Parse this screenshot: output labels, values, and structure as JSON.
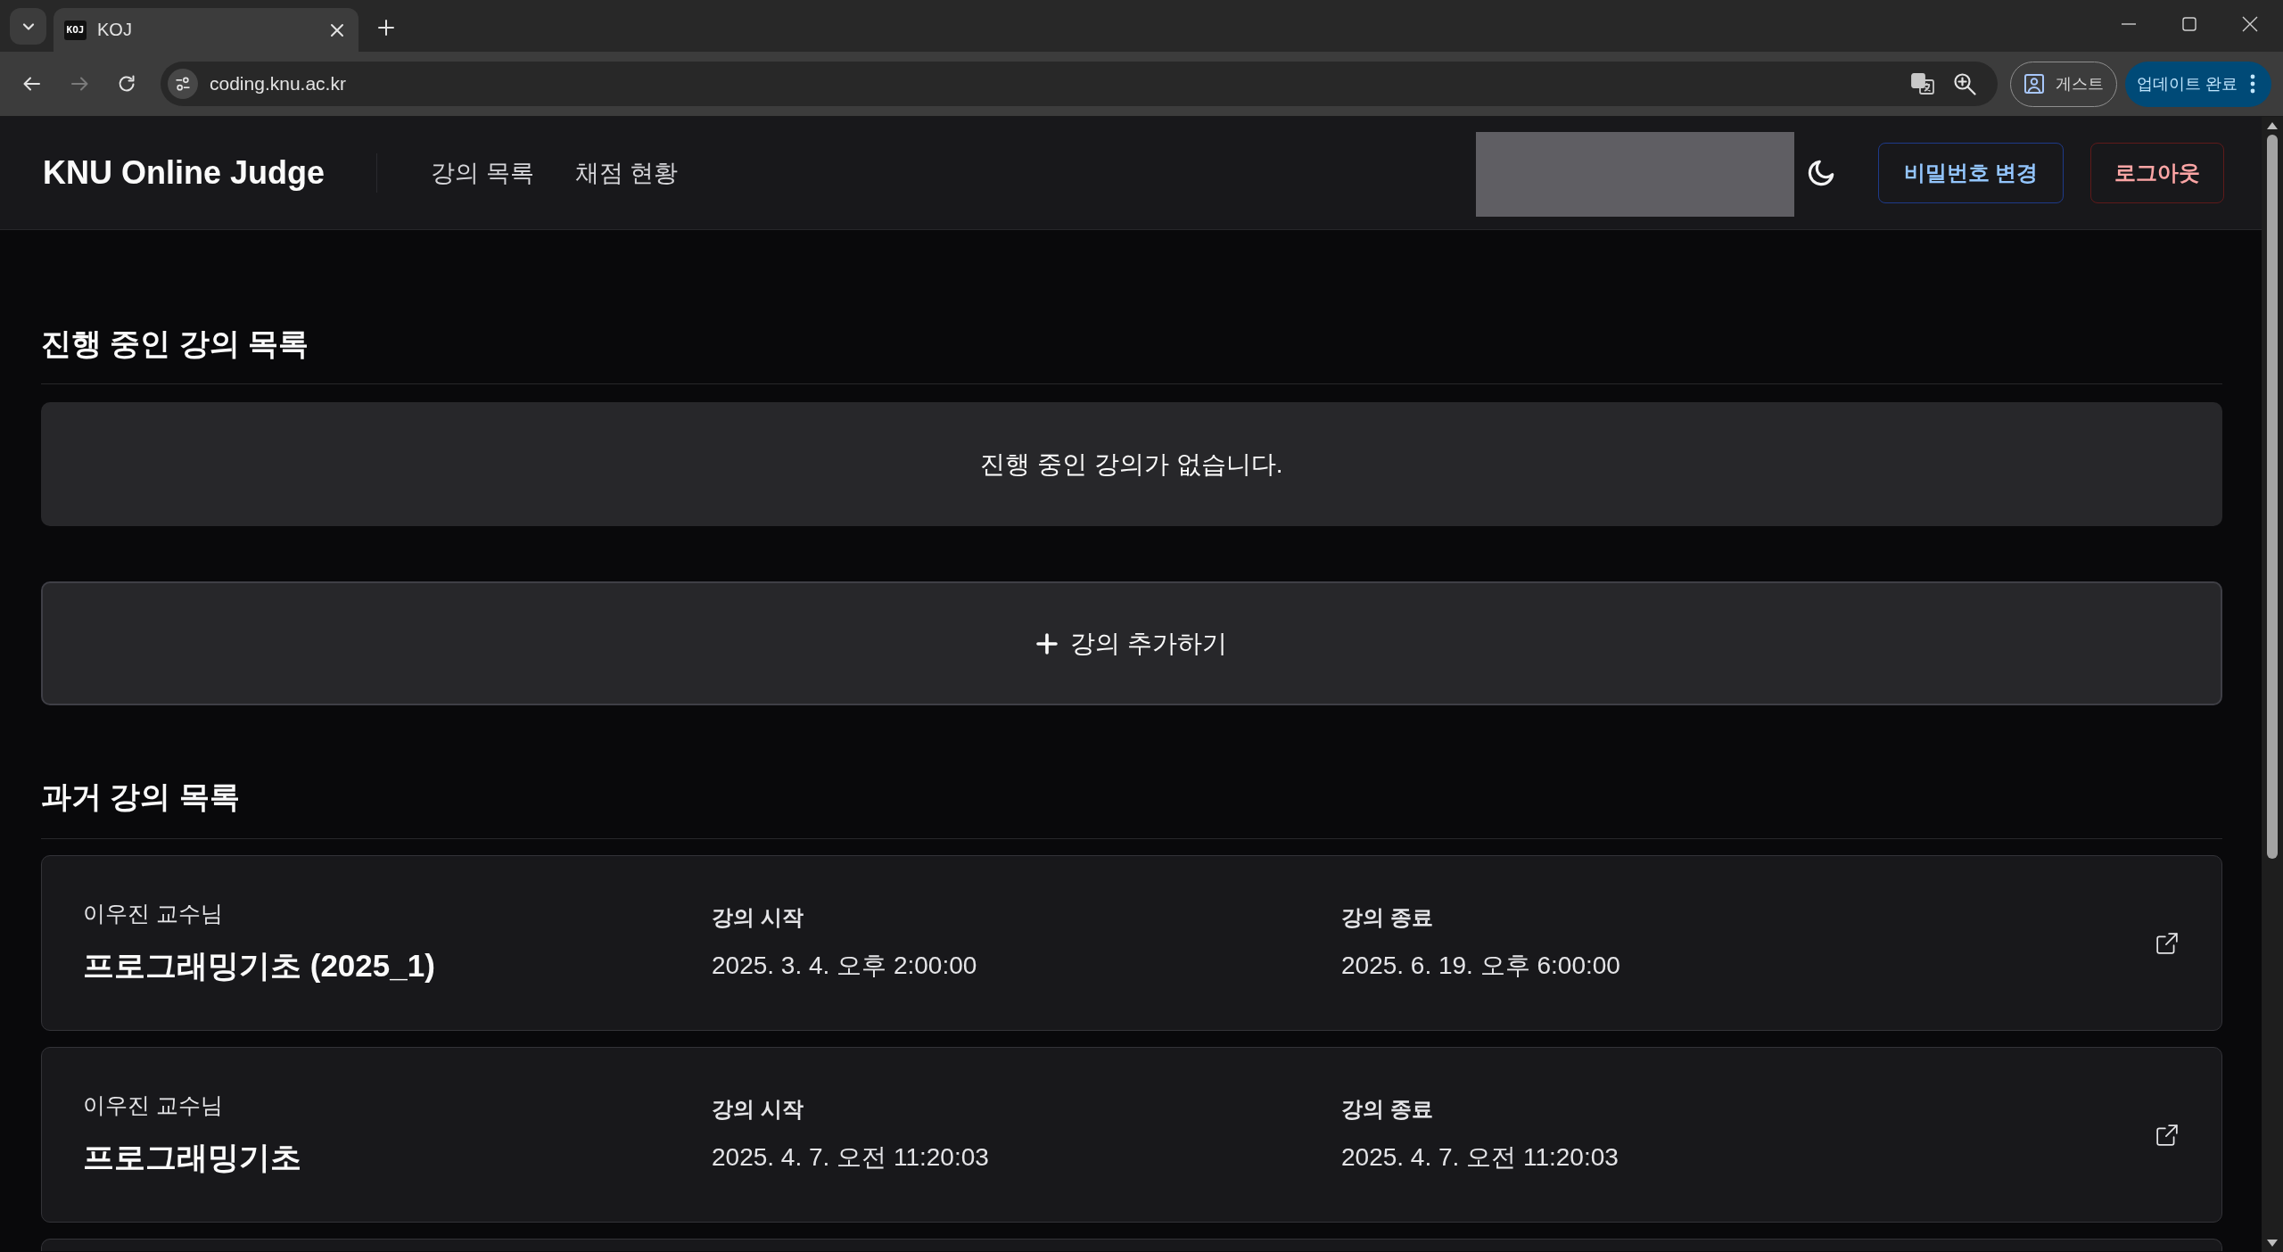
{
  "browser": {
    "tab": {
      "favicon_text": "KOJ",
      "title": "KOJ",
      "selected": true
    },
    "nav_buttons": [
      {
        "kind": "back",
        "disabled": false
      },
      {
        "kind": "forward",
        "disabled": true
      },
      {
        "kind": "reload",
        "disabled": false
      }
    ],
    "address": "coding.knu.ac.kr",
    "profile_label": "게스트",
    "update_label": "업데이트 완료"
  },
  "header": {
    "brand": "KNU Online Judge",
    "nav": [
      {
        "label": "강의 목록",
        "selected": false
      },
      {
        "label": "채점 현황",
        "selected": false
      }
    ],
    "buttons": [
      {
        "label": "비밀번호 변경",
        "kind": "primary"
      },
      {
        "label": "로그아웃",
        "kind": "danger"
      }
    ]
  },
  "current_courses": {
    "title": "진행 중인 강의 목록",
    "empty_message": "진행 중인 강의가 없습니다.",
    "add_label": "강의 추가하기"
  },
  "past_courses": {
    "title": "과거 강의 목록",
    "courses": [
      {
        "instructor": "이우진 교수님",
        "name": "프로그래밍기초 (2025_1)",
        "start_label": "강의 시작",
        "start": "2025. 3. 4. 오후 2:00:00",
        "end_label": "강의 종료",
        "end": "2025. 6. 19. 오후 6:00:00"
      },
      {
        "instructor": "이우진 교수님",
        "name": "프로그래밍기초",
        "start_label": "강의 시작",
        "start": "2025. 4. 7. 오전 11:20:03",
        "end_label": "강의 종료",
        "end": "2025. 4. 7. 오전 11:20:03"
      }
    ]
  }
}
